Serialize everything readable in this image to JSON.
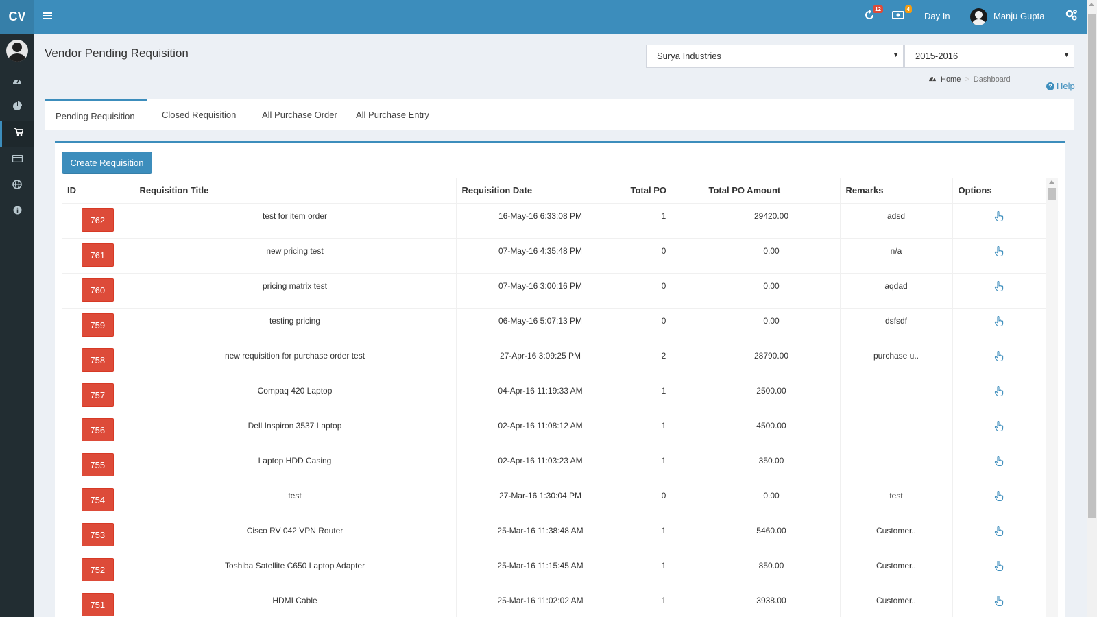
{
  "header": {
    "logo": "CV",
    "notifications_count": "12",
    "messages_count": "4",
    "day_in_label": "Day In",
    "user_name": "Manju Gupta",
    "colors": {
      "header_bg": "#3c8dbc",
      "logo_bg": "#367fa9",
      "sidebar_bg": "#222d32"
    }
  },
  "sidebar": {
    "items": [
      {
        "icon": "dashboard-icon"
      },
      {
        "icon": "pie-chart-icon"
      },
      {
        "icon": "shopping-cart-icon",
        "active": true
      },
      {
        "icon": "credit-card-icon"
      },
      {
        "icon": "globe-icon"
      },
      {
        "icon": "info-icon"
      }
    ]
  },
  "page": {
    "title": "Vendor Pending Requisition",
    "company_select": "Surya Industries",
    "year_select": "2015-2016",
    "breadcrumb_home": "Home",
    "breadcrumb_current": "Dashboard",
    "help_label": "Help"
  },
  "tabs": [
    {
      "label": "Pending Requisition",
      "active": true
    },
    {
      "label": "Closed Requisition"
    },
    {
      "label": "All Purchase Order"
    },
    {
      "label": "All Purchase Entry"
    }
  ],
  "create_button": "Create Requisition",
  "table": {
    "columns": [
      "ID",
      "Requisition Title",
      "Requisition Date",
      "Total PO",
      "Total PO Amount",
      "Remarks",
      "Options"
    ],
    "rows": [
      {
        "id": "762",
        "title": "test for item order",
        "date": "16-May-16 6:33:08 PM",
        "total_po": "1",
        "amount": "29420.00",
        "remarks": "adsd"
      },
      {
        "id": "761",
        "title": "new pricing test",
        "date": "07-May-16 4:35:48 PM",
        "total_po": "0",
        "amount": "0.00",
        "remarks": "n/a"
      },
      {
        "id": "760",
        "title": "pricing matrix test",
        "date": "07-May-16 3:00:16 PM",
        "total_po": "0",
        "amount": "0.00",
        "remarks": "aqdad"
      },
      {
        "id": "759",
        "title": "testing pricing",
        "date": "06-May-16 5:07:13 PM",
        "total_po": "0",
        "amount": "0.00",
        "remarks": "dsfsdf"
      },
      {
        "id": "758",
        "title": "new requisition for purchase order test",
        "date": "27-Apr-16 3:09:25 PM",
        "total_po": "2",
        "amount": "28790.00",
        "remarks": "purchase u.."
      },
      {
        "id": "757",
        "title": "Compaq 420 Laptop",
        "date": "04-Apr-16 11:19:33 AM",
        "total_po": "1",
        "amount": "2500.00",
        "remarks": ""
      },
      {
        "id": "756",
        "title": "Dell Inspiron 3537 Laptop",
        "date": "02-Apr-16 11:08:12 AM",
        "total_po": "1",
        "amount": "4500.00",
        "remarks": ""
      },
      {
        "id": "755",
        "title": "Laptop HDD Casing",
        "date": "02-Apr-16 11:03:23 AM",
        "total_po": "1",
        "amount": "350.00",
        "remarks": ""
      },
      {
        "id": "754",
        "title": "test",
        "date": "27-Mar-16 1:30:04 PM",
        "total_po": "0",
        "amount": "0.00",
        "remarks": "test"
      },
      {
        "id": "753",
        "title": "Cisco RV 042 VPN Router",
        "date": "25-Mar-16 11:38:48 AM",
        "total_po": "1",
        "amount": "5460.00",
        "remarks": "Customer.."
      },
      {
        "id": "752",
        "title": "Toshiba Satellite C650 Laptop Adapter",
        "date": "25-Mar-16 11:15:45 AM",
        "total_po": "1",
        "amount": "850.00",
        "remarks": "Customer.."
      },
      {
        "id": "751",
        "title": "HDMI Cable",
        "date": "25-Mar-16 11:02:02 AM",
        "total_po": "1",
        "amount": "3938.00",
        "remarks": "Customer.."
      }
    ]
  }
}
